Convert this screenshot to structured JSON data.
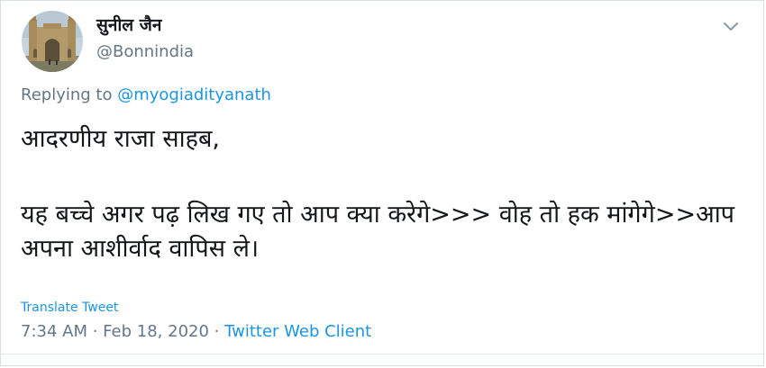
{
  "author": {
    "display_name": "सुनील जैन",
    "handle": "@Bonnindia",
    "avatar": "gateway-of-india-photo"
  },
  "menu": {
    "icon": "chevron-down-icon"
  },
  "reply": {
    "prefix": "Replying to ",
    "mention": "@myogiadityanath"
  },
  "tweet": {
    "line1": "आदरणीय राजा साहब,",
    "line2": "यह बच्चे अगर पढ़ लिख गए तो आप क्या करेगे>>> वोह तो हक मांगेगे>>आप अपना आशीर्वाद वापिस ले।"
  },
  "translate_label": "Translate Tweet",
  "meta": {
    "time": "7:34 AM",
    "separator1": " · ",
    "date": "Feb 18, 2020",
    "separator2": " · ",
    "client": "Twitter Web Client"
  },
  "colors": {
    "link": "#1b95e0",
    "secondary_text": "#657786",
    "primary_text": "#14171a"
  }
}
